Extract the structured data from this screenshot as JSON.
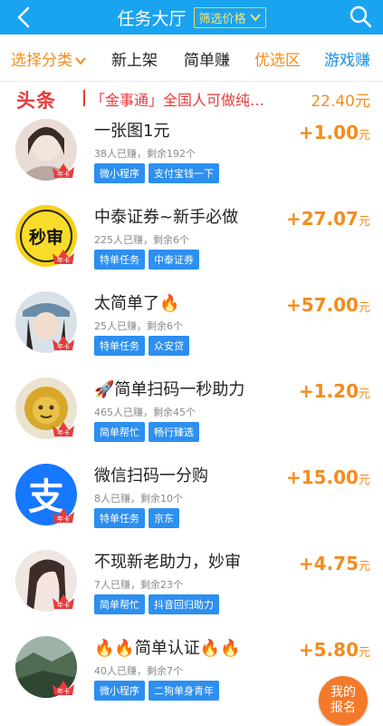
{
  "header": {
    "title": "任务大厅",
    "filter_label": "筛选价格"
  },
  "tabs": [
    {
      "label": "选择分类"
    },
    {
      "label": "新上架"
    },
    {
      "label": "简单赚"
    },
    {
      "label": "优选区"
    },
    {
      "label": "游戏赚"
    }
  ],
  "headline": {
    "brand": "头条",
    "text": "「金事通」全国人可做纯…",
    "price": "22.40元"
  },
  "items": [
    {
      "title": "一张图1元",
      "meta": "38人已赚，剩余192个",
      "tags": [
        "微小程序",
        "支付宝钱一下"
      ],
      "price": "+1.00",
      "unit": "元",
      "badge": "年卡"
    },
    {
      "title": "中泰证券~新手必做",
      "meta": "225人已赚，剩余6个",
      "tags": [
        "特单任务",
        "中泰证券"
      ],
      "price": "+27.07",
      "unit": "元",
      "badge": "年卡",
      "avatar_text": "秒审"
    },
    {
      "title": "太简单了🔥",
      "meta": "25人已赚，剩余6个",
      "tags": [
        "特单任务",
        "众安贷"
      ],
      "price": "+57.00",
      "unit": "元",
      "badge": "年卡"
    },
    {
      "title": "🚀简单扫码一秒助力",
      "meta": "465人已赚，剩余45个",
      "tags": [
        "简单帮忙",
        "畅行臻选"
      ],
      "price": "+1.20",
      "unit": "元",
      "badge": "年卡"
    },
    {
      "title": "微信扫码一分购",
      "meta": "8人已赚，剩余10个",
      "tags": [
        "特单任务",
        "京东"
      ],
      "price": "+15.00",
      "unit": "元",
      "badge": "年卡",
      "avatar_text": "支"
    },
    {
      "title": "不现新老助力，妙审",
      "meta": "7人已赚，剩余23个",
      "tags": [
        "简单帮忙",
        "抖音回归助力"
      ],
      "price": "+4.75",
      "unit": "元",
      "badge": "年卡"
    },
    {
      "title": "🔥🔥简单认证🔥🔥",
      "meta": "40人已赚，剩余7个",
      "tags": [
        "微小程序",
        "二狗单身青年"
      ],
      "price": "+5.80",
      "unit": "元",
      "badge": "年卡"
    }
  ],
  "float_button": {
    "line1": "我的",
    "line2": "报名"
  }
}
